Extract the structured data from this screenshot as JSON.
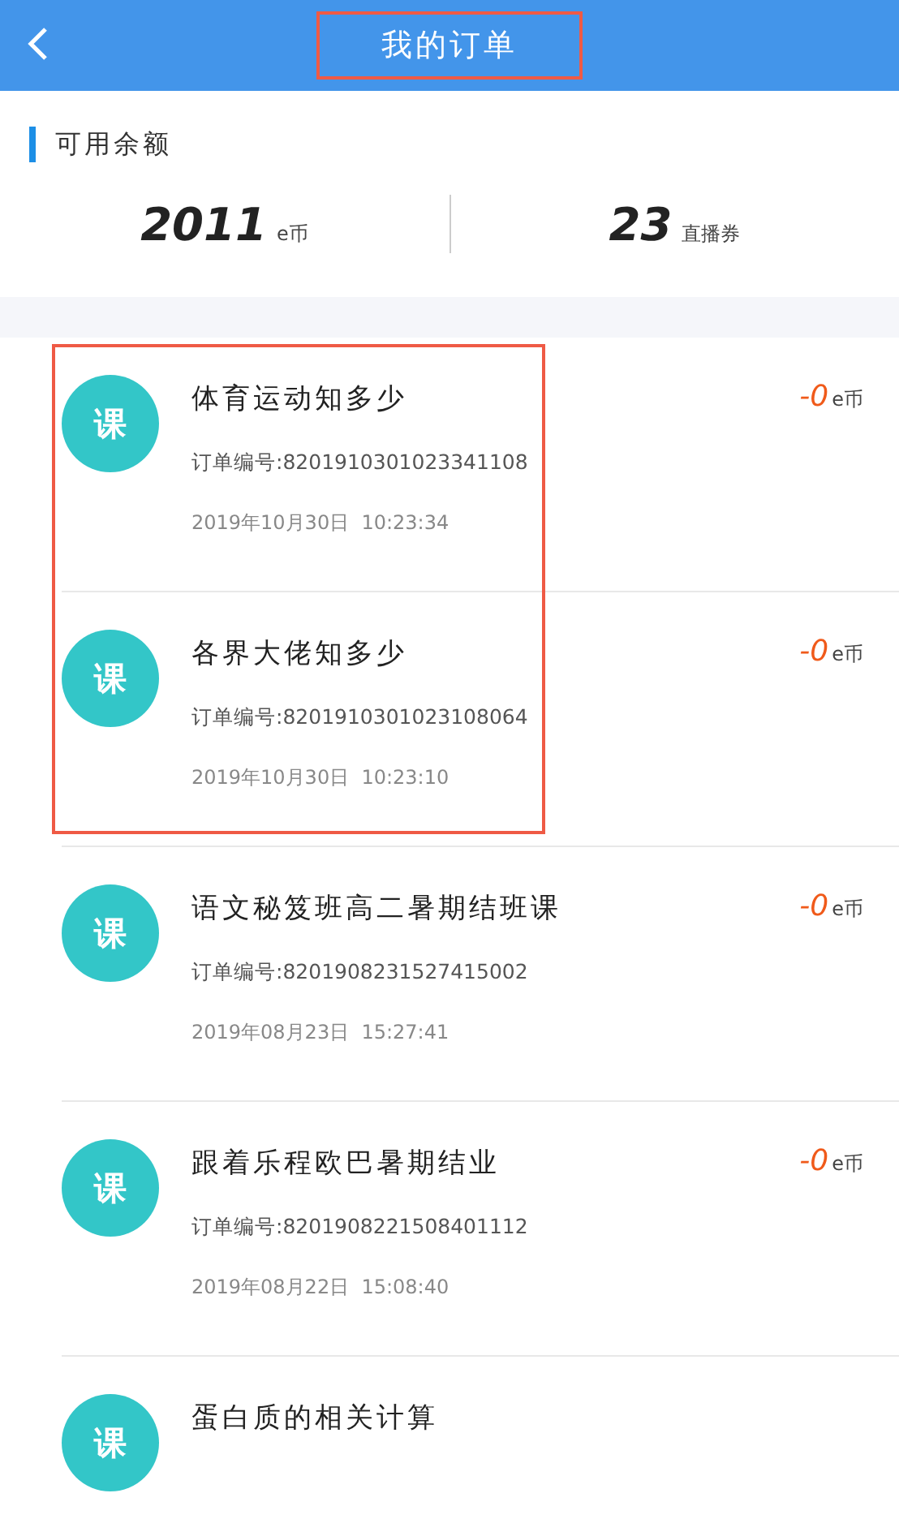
{
  "header": {
    "title": "我的订单",
    "title_highlighted": true
  },
  "balance": {
    "label": "可用余额",
    "items": [
      {
        "value": "2011",
        "unit": "e币"
      },
      {
        "value": "23",
        "unit": "直播券"
      }
    ]
  },
  "orders": [
    {
      "badge": "课",
      "title": "体育运动知多少",
      "order_no": "订单编号:8201910301023341108",
      "time": "2019年10月30日  10:23:34",
      "amount": "-0",
      "unit": "e币",
      "highlighted": true
    },
    {
      "badge": "课",
      "title": "各界大佬知多少",
      "order_no": "订单编号:8201910301023108064",
      "time": "2019年10月30日  10:23:10",
      "amount": "-0",
      "unit": "e币",
      "highlighted": true
    },
    {
      "badge": "课",
      "title": "语文秘笈班高二暑期结班课",
      "order_no": "订单编号:8201908231527415002",
      "time": "2019年08月23日  15:27:41",
      "amount": "-0",
      "unit": "e币",
      "highlighted": false
    },
    {
      "badge": "课",
      "title": "跟着乐程欧巴暑期结业",
      "order_no": "订单编号:8201908221508401112",
      "time": "2019年08月22日  15:08:40",
      "amount": "-0",
      "unit": "e币",
      "highlighted": false
    },
    {
      "badge": "课",
      "title": "蛋白质的相关计算",
      "highlighted": false
    }
  ]
}
